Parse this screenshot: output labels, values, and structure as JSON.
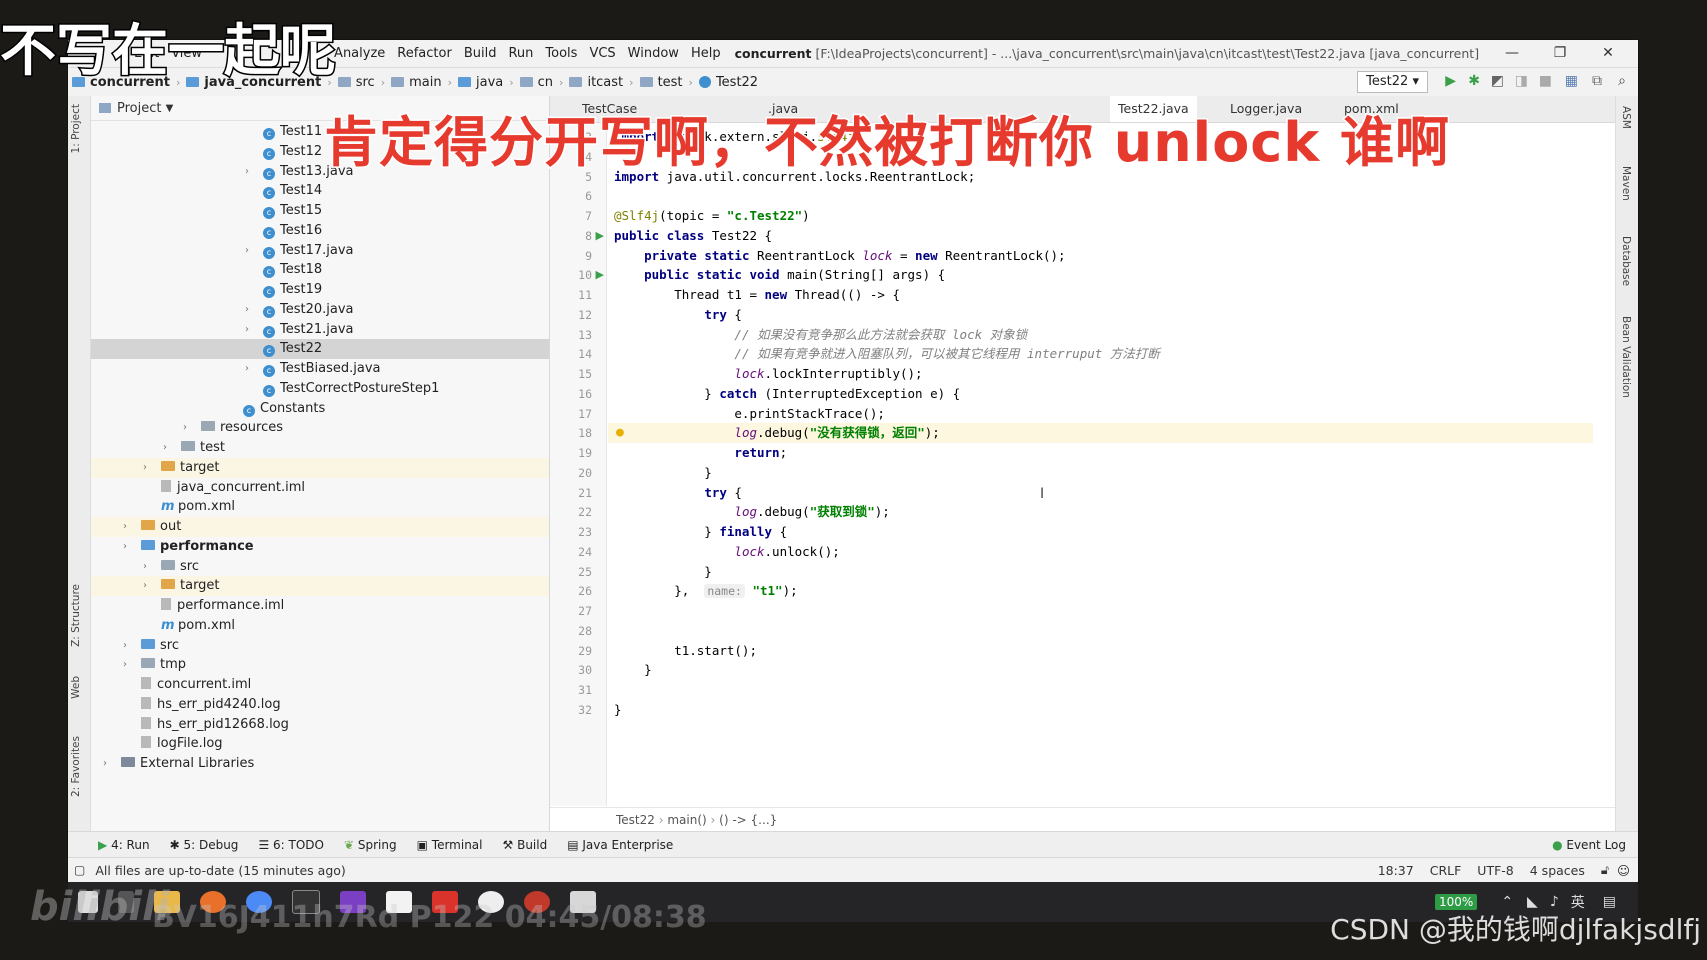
{
  "overlays": {
    "top_left_caption": "不写在一起呢",
    "main_caption": "肯定得分开写啊，不然被打断你 unlock 谁啊",
    "bilibili_logo": "bilibili",
    "video_info": "BV16J411h7Rd P122 04:45/08:38",
    "csdn_watermark": "CSDN @我的钱啊djlfakjsdlfj"
  },
  "menu": [
    "Edit",
    "View",
    "Analyze",
    "Refactor",
    "Build",
    "Run",
    "Tools",
    "VCS",
    "Window",
    "Help"
  ],
  "window_title": {
    "project": "concurrent",
    "path": "[F:\\IdeaProjects\\concurrent] - ...\\java_concurrent\\src\\main\\java\\cn\\itcast\\test\\Test22.java [java_concurrent]"
  },
  "breadcrumb": [
    "concurrent",
    "java_concurrent",
    "src",
    "main",
    "java",
    "cn",
    "itcast",
    "test",
    "Test22"
  ],
  "run_config": "Test22",
  "project_panel": {
    "title": "Project",
    "items": [
      {
        "label": "Test11",
        "type": "class",
        "indent": 172,
        "arrow": false,
        "state": ""
      },
      {
        "label": "Test12",
        "type": "class",
        "indent": 172,
        "arrow": false,
        "state": ""
      },
      {
        "label": "Test13.java",
        "type": "class",
        "indent": 172,
        "arrow": true,
        "state": ""
      },
      {
        "label": "Test14",
        "type": "class",
        "indent": 172,
        "arrow": false,
        "state": ""
      },
      {
        "label": "Test15",
        "type": "class",
        "indent": 172,
        "arrow": false,
        "state": ""
      },
      {
        "label": "Test16",
        "type": "class",
        "indent": 172,
        "arrow": false,
        "state": ""
      },
      {
        "label": "Test17.java",
        "type": "class",
        "indent": 172,
        "arrow": true,
        "state": ""
      },
      {
        "label": "Test18",
        "type": "class",
        "indent": 172,
        "arrow": false,
        "state": ""
      },
      {
        "label": "Test19",
        "type": "class",
        "indent": 172,
        "arrow": false,
        "state": ""
      },
      {
        "label": "Test20.java",
        "type": "class",
        "indent": 172,
        "arrow": true,
        "state": ""
      },
      {
        "label": "Test21.java",
        "type": "class",
        "indent": 172,
        "arrow": true,
        "state": ""
      },
      {
        "label": "Test22",
        "type": "class",
        "indent": 172,
        "arrow": false,
        "state": "sel"
      },
      {
        "label": "TestBiased.java",
        "type": "class",
        "indent": 172,
        "arrow": true,
        "state": ""
      },
      {
        "label": "TestCorrectPostureStep1",
        "type": "class",
        "indent": 172,
        "arrow": false,
        "state": ""
      },
      {
        "label": "Constants",
        "type": "class",
        "indent": 152,
        "arrow": false,
        "state": ""
      },
      {
        "label": "resources",
        "type": "folder",
        "indent": 110,
        "arrow": true,
        "state": ""
      },
      {
        "label": "test",
        "type": "folder",
        "indent": 90,
        "arrow": true,
        "state": ""
      },
      {
        "label": "target",
        "type": "folder-or",
        "indent": 70,
        "arrow": true,
        "state": "hl"
      },
      {
        "label": "java_concurrent.iml",
        "type": "file",
        "indent": 70,
        "arrow": false,
        "state": ""
      },
      {
        "label": "pom.xml",
        "type": "maven",
        "indent": 70,
        "arrow": false,
        "state": ""
      },
      {
        "label": "out",
        "type": "folder-or",
        "indent": 50,
        "arrow": true,
        "state": "hl"
      },
      {
        "label": "performance",
        "type": "folder-bl",
        "indent": 50,
        "arrow": true,
        "state": "",
        "bold": true
      },
      {
        "label": "src",
        "type": "folder",
        "indent": 70,
        "arrow": true,
        "state": ""
      },
      {
        "label": "target",
        "type": "folder-or",
        "indent": 70,
        "arrow": true,
        "state": "hl"
      },
      {
        "label": "performance.iml",
        "type": "file",
        "indent": 70,
        "arrow": false,
        "state": ""
      },
      {
        "label": "pom.xml",
        "type": "maven",
        "indent": 70,
        "arrow": false,
        "state": ""
      },
      {
        "label": "src",
        "type": "folder-bl",
        "indent": 50,
        "arrow": true,
        "state": ""
      },
      {
        "label": "tmp",
        "type": "folder",
        "indent": 50,
        "arrow": true,
        "state": ""
      },
      {
        "label": "concurrent.iml",
        "type": "file",
        "indent": 50,
        "arrow": false,
        "state": ""
      },
      {
        "label": "hs_err_pid4240.log",
        "type": "file",
        "indent": 50,
        "arrow": false,
        "state": ""
      },
      {
        "label": "hs_err_pid12668.log",
        "type": "file",
        "indent": 50,
        "arrow": false,
        "state": ""
      },
      {
        "label": "logFile.log",
        "type": "file",
        "indent": 50,
        "arrow": false,
        "state": ""
      },
      {
        "label": "External Libraries",
        "type": "lib",
        "indent": 30,
        "arrow": true,
        "state": ""
      }
    ]
  },
  "editor_tabs": [
    "TestCase",
    ".java",
    "Test22.java",
    "Logger.java",
    "pom.xml"
  ],
  "code_lines": [
    {
      "n": "3",
      "html": "<span class='kw'>import</span> lombok.extern.slf4j.<span class='an'>Slf4j</span>;"
    },
    {
      "n": "4",
      "html": ""
    },
    {
      "n": "5",
      "html": "<span class='kw'>import</span> java.util.concurrent.locks.ReentrantLock;"
    },
    {
      "n": "6",
      "html": ""
    },
    {
      "n": "7",
      "html": "<span class='an'>@Slf4j</span>(topic = <span class='st'>\"c.Test22\"</span>)"
    },
    {
      "n": "8",
      "html": "<span class='kw'>public class</span> Test22 {"
    },
    {
      "n": "9",
      "html": "    <span class='kw'>private static</span> ReentrantLock <span class='fd'>lock</span> = <span class='kw'>new</span> ReentrantLock();"
    },
    {
      "n": "10",
      "html": "    <span class='kw'>public static void</span> main(String[] args) {"
    },
    {
      "n": "11",
      "html": "        Thread t1 = <span class='kw'>new</span> Thread(() -> {"
    },
    {
      "n": "12",
      "html": "            <span class='kw'>try</span> {"
    },
    {
      "n": "13",
      "html": "                <span class='cm'>// 如果没有竞争那么此方法就会获取 lock 对象锁</span>"
    },
    {
      "n": "14",
      "html": "                <span class='cm'>// 如果有竞争就进入阻塞队列，可以被其它线程用 interruput 方法打断</span>"
    },
    {
      "n": "15",
      "html": "                <span class='fd'>lock</span>.lockInterruptibly();"
    },
    {
      "n": "16",
      "html": "            } <span class='kw'>catch</span> (InterruptedException e) {"
    },
    {
      "n": "17",
      "html": "                e.printStackTrace();"
    },
    {
      "n": "18",
      "html": "                <span class='fd'>log</span>.debug(<span class='st'>\"没有获得锁，返回\"</span>);"
    },
    {
      "n": "19",
      "html": "                <span class='kw'>return</span>;"
    },
    {
      "n": "20",
      "html": "            }"
    },
    {
      "n": "21",
      "html": "            <span class='kw'>try</span> {"
    },
    {
      "n": "22",
      "html": "                <span class='fd'>log</span>.debug(<span class='st'>\"获取到锁\"</span>);"
    },
    {
      "n": "23",
      "html": "            } <span class='kw'>finally</span> {"
    },
    {
      "n": "24",
      "html": "                <span class='fd'>lock</span>.unlock();"
    },
    {
      "n": "25",
      "html": "            }"
    },
    {
      "n": "26",
      "html": "        },  <span class='hint'>name:</span> <span class='st'>\"t1\"</span>);"
    },
    {
      "n": "27",
      "html": ""
    },
    {
      "n": "28",
      "html": ""
    },
    {
      "n": "29",
      "html": "        t1.start();"
    },
    {
      "n": "30",
      "html": "    }"
    },
    {
      "n": "31",
      "html": ""
    },
    {
      "n": "32",
      "html": "}"
    }
  ],
  "editor_breadcrumb": [
    "Test22",
    "main()",
    "() -> {...}"
  ],
  "bottom_tabs": [
    "4: Run",
    "5: Debug",
    "6: TODO",
    "Spring",
    "Terminal",
    "Build",
    "Java Enterprise"
  ],
  "event_log": "Event Log",
  "status": {
    "message": "All files are up-to-date (15 minutes ago)",
    "position": "18:37",
    "line_sep": "CRLF",
    "encoding": "UTF-8",
    "indent": "4 spaces"
  },
  "left_tool_windows": [
    "1: Project",
    "Z: Structure",
    "Web",
    "2: Favorites"
  ],
  "right_tool_windows": [
    "ASM",
    "Maven",
    "Database",
    "Bean Validation"
  ],
  "taskbar": {
    "battery": "100%",
    "ime": "英"
  }
}
